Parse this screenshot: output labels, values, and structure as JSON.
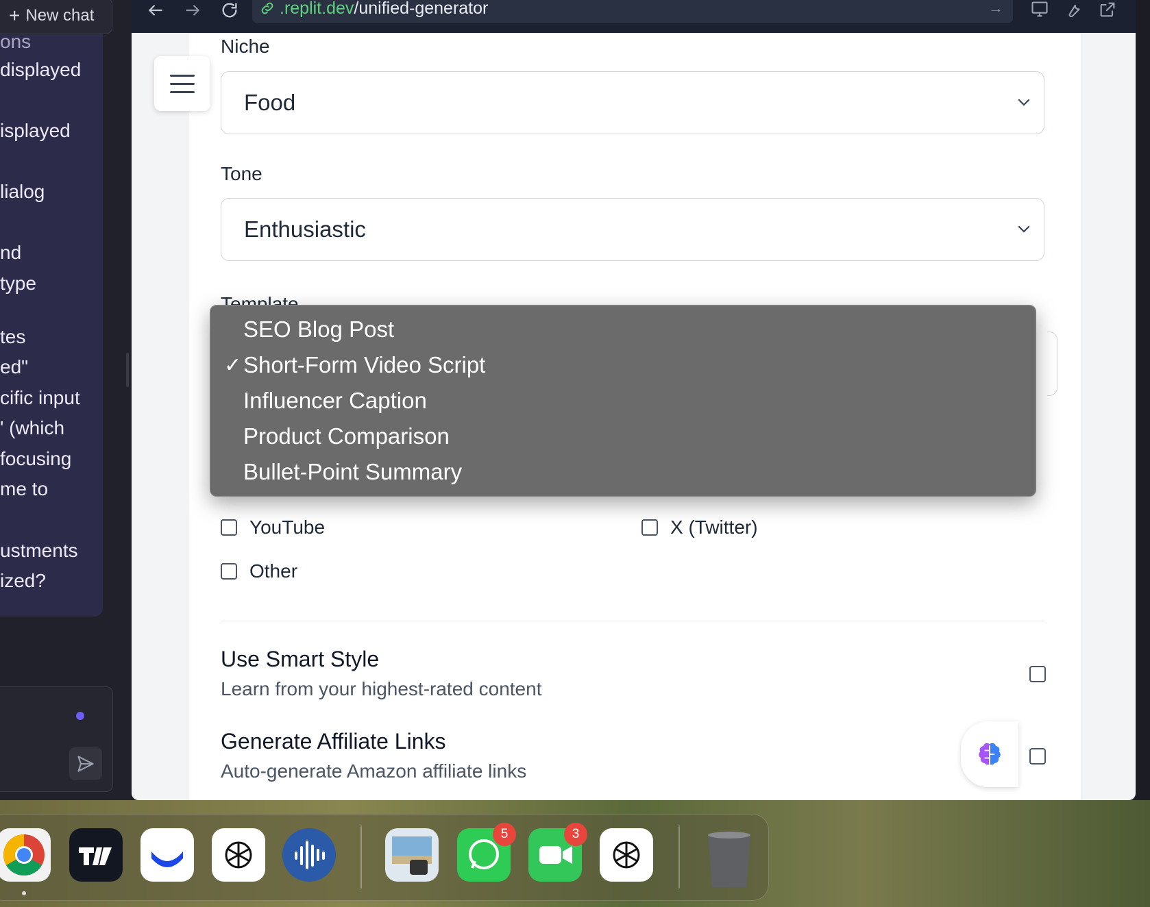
{
  "left_panel": {
    "new_chat_label": "New chat",
    "chat_lines": [
      "ons",
      "displayed",
      "isplayed",
      "lialog",
      "nd",
      "type",
      "tes",
      "ed\"",
      "cific input",
      "' (which",
      "focusing",
      " me to",
      "ustments",
      "ized?"
    ]
  },
  "browser": {
    "url_domain": ".replit.dev",
    "url_path": "/unified-generator"
  },
  "form": {
    "niche_label": "Niche",
    "niche_value": "Food",
    "tone_label": "Tone",
    "tone_value": "Enthusiastic",
    "template_label": "Template",
    "template_options": [
      "SEO Blog Post",
      "Short-Form Video Script",
      "Influencer Caption",
      "Product Comparison",
      "Bullet-Point Summary"
    ],
    "template_selected": "Short-Form Video Script",
    "checkmark": "✓",
    "platforms": {
      "youtube": "YouTube",
      "x_twitter": "X (Twitter)",
      "other": "Other"
    },
    "smart_style_title": "Use Smart Style",
    "smart_style_desc": "Learn from your highest-rated content",
    "affiliate_title": "Generate Affiliate Links",
    "affiliate_desc": "Auto-generate Amazon affiliate links"
  },
  "dock": {
    "apps": [
      "chrome-icon",
      "tradingview-icon",
      "wise-icon",
      "chatgpt-icon",
      "audio-app-icon",
      "preview-icon",
      "whatsapp-icon",
      "facetime-icon",
      "chatgpt-ipad-icon",
      "trash-icon"
    ],
    "whatsapp_badge": "5",
    "facetime_badge": "3"
  },
  "colors": {
    "url_domain": "#5fd07c",
    "dropdown_bg": "#6b6b6b",
    "accent_dot": "#6d5df5",
    "badge": "#e8453c"
  }
}
